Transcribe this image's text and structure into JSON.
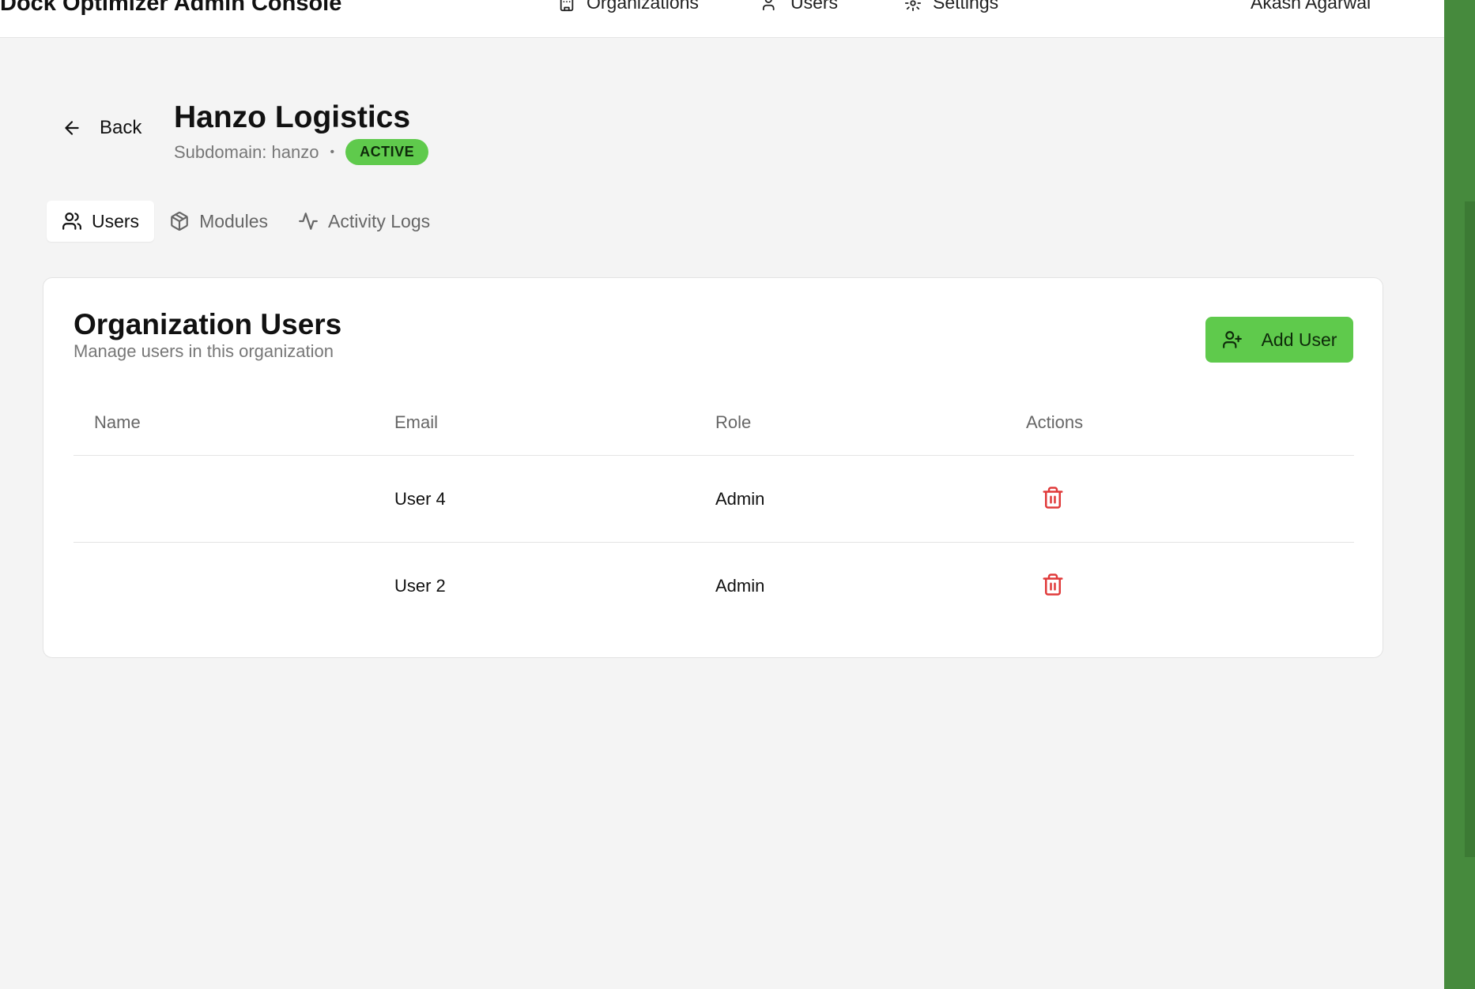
{
  "header": {
    "app_title": "Dock Optimizer Admin Console",
    "nav": [
      {
        "label": "Organizations",
        "icon": "building-icon"
      },
      {
        "label": "Users",
        "icon": "users-icon"
      },
      {
        "label": "Settings",
        "icon": "gear-icon"
      }
    ],
    "user_name": "Akash Agarwal"
  },
  "page": {
    "back_label": "Back",
    "org_name": "Hanzo Logistics",
    "subdomain": "Subdomain: hanzo",
    "separator": "•",
    "status": "ACTIVE"
  },
  "tabs": [
    {
      "label": "Users",
      "icon": "users-icon",
      "active": true
    },
    {
      "label": "Modules",
      "icon": "package-icon",
      "active": false
    },
    {
      "label": "Activity Logs",
      "icon": "activity-icon",
      "active": false
    }
  ],
  "users_card": {
    "title": "Organization Users",
    "subtitle": "Manage users in this organization",
    "add_button_label": "Add User",
    "columns": [
      "Name",
      "Email",
      "Role",
      "Actions"
    ],
    "rows": [
      {
        "name": "",
        "email": "User 4",
        "role": "Admin",
        "action_icon": "trash-icon"
      },
      {
        "name": "",
        "email": "User 2",
        "role": "Admin",
        "action_icon": "trash-icon"
      }
    ]
  },
  "colors": {
    "accent": "#5fca4c",
    "danger": "#e03a3a",
    "background": "#f4f4f4",
    "side_strip": "#468a3d"
  }
}
